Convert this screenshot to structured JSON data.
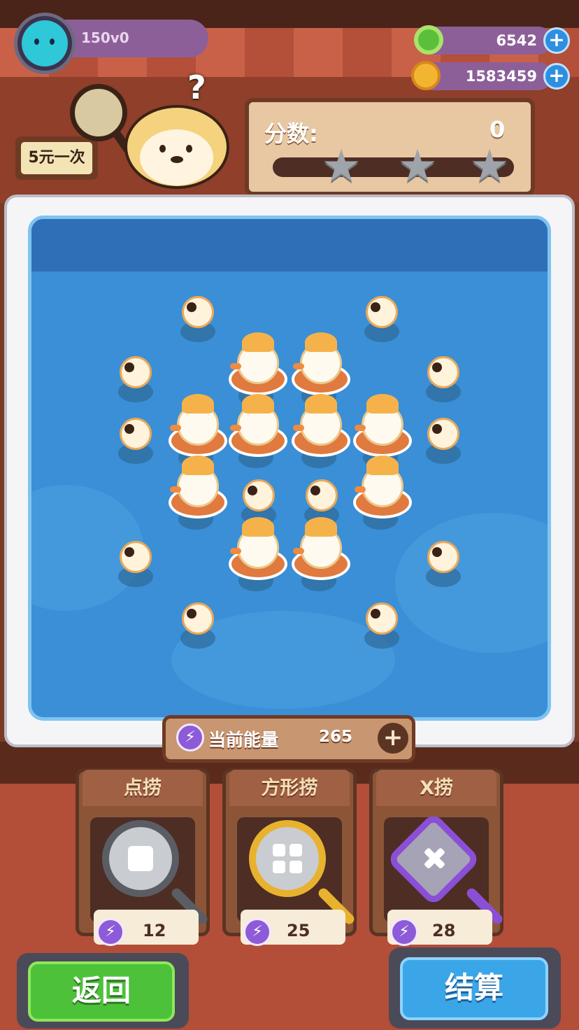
{
  "player": {
    "name": "150v0",
    "avatar_icon": "cat-avatar-icon"
  },
  "currency": [
    {
      "icon": "donut-coin-icon",
      "value": "6542",
      "plus": "+"
    },
    {
      "icon": "planet-coin-icon",
      "value": "1583459",
      "plus": "+"
    }
  ],
  "sign": {
    "text": "5元一次"
  },
  "score": {
    "label": "分数:",
    "value": "0",
    "stars": [
      "★",
      "★",
      "★"
    ]
  },
  "otter": {
    "question": "?"
  },
  "energy": {
    "label": "当前能量",
    "value": "265",
    "plus": "+",
    "icon": "lightning-icon",
    "bolt": "⚡"
  },
  "tools": [
    {
      "title": "点捞",
      "cost": "12",
      "icon": "single-net-icon"
    },
    {
      "title": "方形捞",
      "cost": "25",
      "icon": "square-net-icon"
    },
    {
      "title": "X捞",
      "cost": "28",
      "icon": "x-net-icon"
    }
  ],
  "buttons": {
    "back": "返回",
    "settle": "结算"
  },
  "colors": {
    "pool": "#3a8fd6",
    "back_button": "#4dc13a",
    "settle_button": "#3aa6e8",
    "energy_accent": "#8d5bd8"
  }
}
